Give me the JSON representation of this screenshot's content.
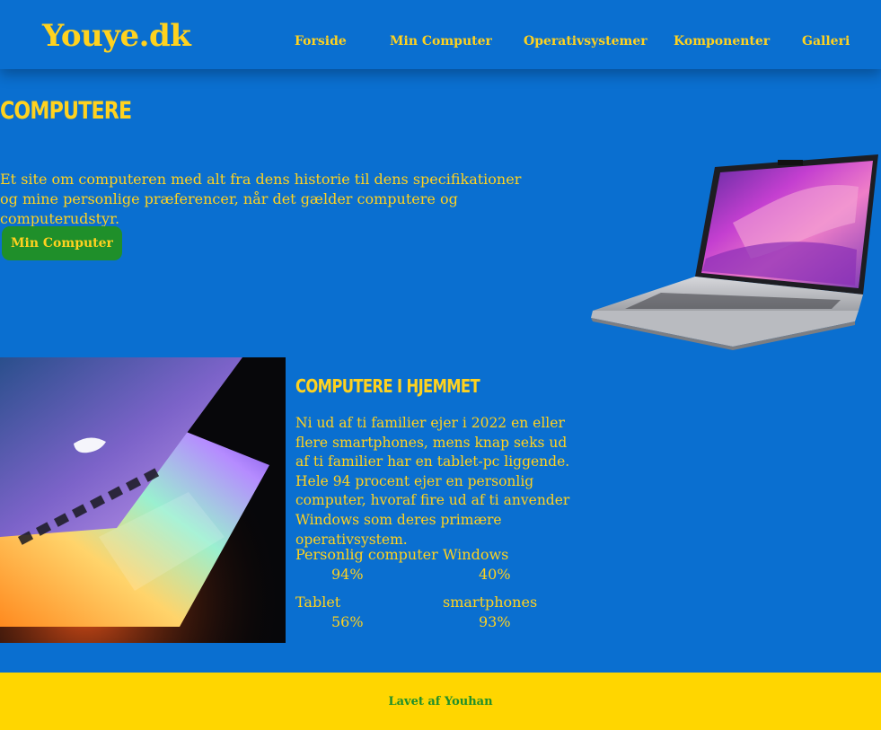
{
  "header": {
    "logo": "Youye.dk",
    "nav": [
      "Forside",
      "Min Computer",
      "Operativsystemer",
      "Komponenter",
      "Galleri"
    ]
  },
  "hero": {
    "title": "COMPUTERE",
    "text": "Et site om computeren med alt fra dens historie til dens specifikationer og mine personlige præferencer, når det gælder computere og computerudstyr.",
    "button": "Min Computer"
  },
  "section": {
    "title": "COMPUTERE I HJEMMET",
    "text": "Ni ud af ti familier ejer i 2022 en eller flere smartphones, mens knap seks ud af ti familier har en tablet-pc liggende. Hele 94 procent ejer en personlig computer, hvoraf fire ud af ti anvender Windows som deres primære operativsystem.",
    "stats": [
      {
        "label": "Personlig computer",
        "value": "94%"
      },
      {
        "label": "Windows",
        "value": "40%"
      },
      {
        "label": "Tablet",
        "value": "56%"
      },
      {
        "label": "smartphones",
        "value": "93%"
      }
    ]
  },
  "footer": {
    "text": "Lavet af Youhan"
  },
  "colors": {
    "background": "#0a6fd0",
    "text": "#ffd21f",
    "button": "#1f8f2a",
    "footer": "#ffd600"
  }
}
